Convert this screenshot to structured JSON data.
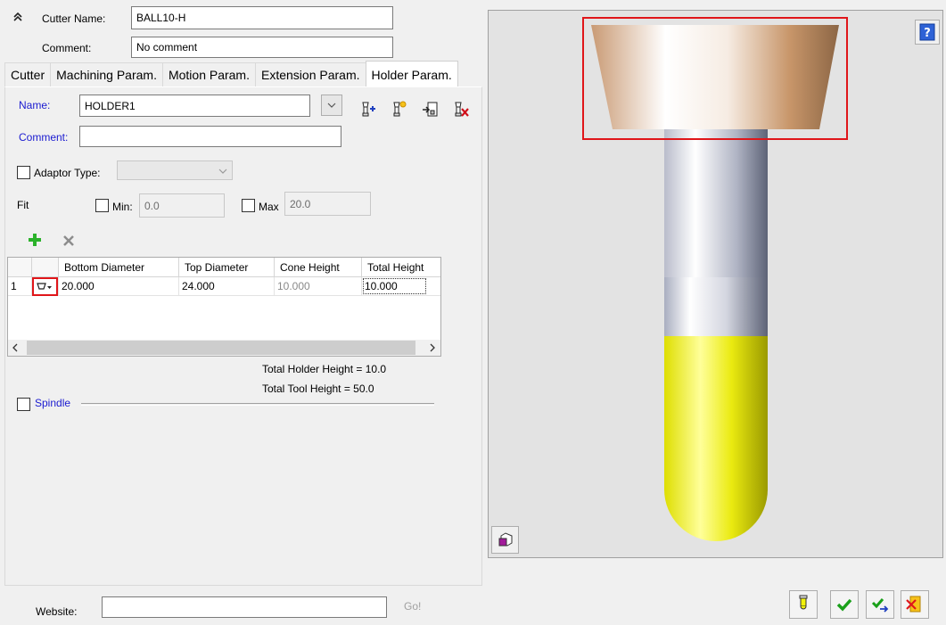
{
  "header": {
    "collapse_icon": "double-chevron-up-icon",
    "cutter_name_label": "Cutter Name:",
    "cutter_name_value": "BALL10-H",
    "comment_label": "Comment:",
    "comment_value": "No comment"
  },
  "tabs": [
    {
      "label": "Cutter",
      "active": false
    },
    {
      "label": "Machining Param.",
      "active": false
    },
    {
      "label": "Motion Param.",
      "active": false
    },
    {
      "label": "Extension Param.",
      "active": false
    },
    {
      "label": "Holder Param.",
      "active": true
    }
  ],
  "holder": {
    "name_label": "Name:",
    "name_value": "HOLDER1",
    "comment_label": "Comment:",
    "comment_value": "",
    "adaptor_label": "Adaptor Type:",
    "adaptor_value": "",
    "fit_label": "Fit",
    "min_label": "Min:",
    "min_value": "0.0",
    "max_label": "Max",
    "max_value": "20.0"
  },
  "table": {
    "columns": [
      "",
      "",
      "Bottom Diameter",
      "Top Diameter",
      "Cone Height",
      "Total Height"
    ],
    "rows": [
      {
        "index": "1",
        "shape_icon": "cone-shape-icon",
        "bottom_diameter": "20.000",
        "top_diameter": "24.000",
        "cone_height": "10.000",
        "total_height": "10.000"
      }
    ]
  },
  "totals": {
    "holder_height": "Total Holder Height = 10.0",
    "tool_height": "Total Tool Height = 50.0"
  },
  "spindle_label": "Spindle",
  "footer": {
    "website_label": "Website:",
    "website_value": "",
    "go_label": "Go!"
  },
  "colors": {
    "accent_blue": "#1b1bd0",
    "highlight_red": "#e0161a",
    "holder_tan": "#d9a27a",
    "shank_grey": "#8f96a8",
    "flute_yellow": "#f2f20a"
  }
}
